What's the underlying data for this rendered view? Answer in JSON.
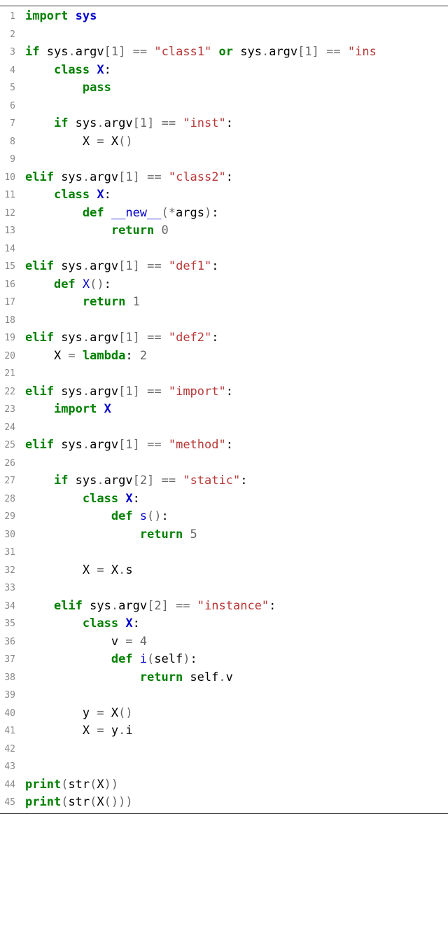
{
  "lines": [
    {
      "n": 1,
      "tokens": [
        [
          "kw-green",
          "import"
        ],
        [
          "plain",
          " "
        ],
        [
          "kw-blue",
          "sys"
        ]
      ]
    },
    {
      "n": 2,
      "tokens": []
    },
    {
      "n": 3,
      "tokens": [
        [
          "kw-green",
          "if"
        ],
        [
          "plain",
          " sys"
        ],
        [
          "op",
          "."
        ],
        [
          "plain",
          "argv"
        ],
        [
          "op",
          "["
        ],
        [
          "num",
          "1"
        ],
        [
          "op",
          "]"
        ],
        [
          "plain",
          " "
        ],
        [
          "op",
          "=="
        ],
        [
          "plain",
          " "
        ],
        [
          "str",
          "\"class1\""
        ],
        [
          "plain",
          " "
        ],
        [
          "kw-green",
          "or"
        ],
        [
          "plain",
          " sys"
        ],
        [
          "op",
          "."
        ],
        [
          "plain",
          "argv"
        ],
        [
          "op",
          "["
        ],
        [
          "num",
          "1"
        ],
        [
          "op",
          "]"
        ],
        [
          "plain",
          " "
        ],
        [
          "op",
          "=="
        ],
        [
          "plain",
          " "
        ],
        [
          "str",
          "\"ins"
        ]
      ]
    },
    {
      "n": 4,
      "tokens": [
        [
          "plain",
          "    "
        ],
        [
          "kw-green",
          "class"
        ],
        [
          "plain",
          " "
        ],
        [
          "kw-blue",
          "X"
        ],
        [
          "plain",
          ":"
        ]
      ]
    },
    {
      "n": 5,
      "tokens": [
        [
          "plain",
          "        "
        ],
        [
          "kw-green",
          "pass"
        ]
      ]
    },
    {
      "n": 6,
      "tokens": []
    },
    {
      "n": 7,
      "tokens": [
        [
          "plain",
          "    "
        ],
        [
          "kw-green",
          "if"
        ],
        [
          "plain",
          " sys"
        ],
        [
          "op",
          "."
        ],
        [
          "plain",
          "argv"
        ],
        [
          "op",
          "["
        ],
        [
          "num",
          "1"
        ],
        [
          "op",
          "]"
        ],
        [
          "plain",
          " "
        ],
        [
          "op",
          "=="
        ],
        [
          "plain",
          " "
        ],
        [
          "str",
          "\"inst\""
        ],
        [
          "plain",
          ":"
        ]
      ]
    },
    {
      "n": 8,
      "tokens": [
        [
          "plain",
          "        X "
        ],
        [
          "op",
          "="
        ],
        [
          "plain",
          " X"
        ],
        [
          "op",
          "()"
        ]
      ]
    },
    {
      "n": 9,
      "tokens": []
    },
    {
      "n": 10,
      "tokens": [
        [
          "kw-green",
          "elif"
        ],
        [
          "plain",
          " sys"
        ],
        [
          "op",
          "."
        ],
        [
          "plain",
          "argv"
        ],
        [
          "op",
          "["
        ],
        [
          "num",
          "1"
        ],
        [
          "op",
          "]"
        ],
        [
          "plain",
          " "
        ],
        [
          "op",
          "=="
        ],
        [
          "plain",
          " "
        ],
        [
          "str",
          "\"class2\""
        ],
        [
          "plain",
          ":"
        ]
      ]
    },
    {
      "n": 11,
      "tokens": [
        [
          "plain",
          "    "
        ],
        [
          "kw-green",
          "class"
        ],
        [
          "plain",
          " "
        ],
        [
          "kw-blue",
          "X"
        ],
        [
          "plain",
          ":"
        ]
      ]
    },
    {
      "n": 12,
      "tokens": [
        [
          "plain",
          "        "
        ],
        [
          "kw-green",
          "def"
        ],
        [
          "plain",
          " "
        ],
        [
          "fn",
          "__new__"
        ],
        [
          "op",
          "(*"
        ],
        [
          "plain",
          "args"
        ],
        [
          "op",
          ")"
        ],
        [
          "plain",
          ":"
        ]
      ]
    },
    {
      "n": 13,
      "tokens": [
        [
          "plain",
          "            "
        ],
        [
          "kw-green",
          "return"
        ],
        [
          "plain",
          " "
        ],
        [
          "num",
          "0"
        ]
      ]
    },
    {
      "n": 14,
      "tokens": []
    },
    {
      "n": 15,
      "tokens": [
        [
          "kw-green",
          "elif"
        ],
        [
          "plain",
          " sys"
        ],
        [
          "op",
          "."
        ],
        [
          "plain",
          "argv"
        ],
        [
          "op",
          "["
        ],
        [
          "num",
          "1"
        ],
        [
          "op",
          "]"
        ],
        [
          "plain",
          " "
        ],
        [
          "op",
          "=="
        ],
        [
          "plain",
          " "
        ],
        [
          "str",
          "\"def1\""
        ],
        [
          "plain",
          ":"
        ]
      ]
    },
    {
      "n": 16,
      "tokens": [
        [
          "plain",
          "    "
        ],
        [
          "kw-green",
          "def"
        ],
        [
          "plain",
          " "
        ],
        [
          "fn",
          "X"
        ],
        [
          "op",
          "()"
        ],
        [
          "plain",
          ":"
        ]
      ]
    },
    {
      "n": 17,
      "tokens": [
        [
          "plain",
          "        "
        ],
        [
          "kw-green",
          "return"
        ],
        [
          "plain",
          " "
        ],
        [
          "num",
          "1"
        ]
      ]
    },
    {
      "n": 18,
      "tokens": []
    },
    {
      "n": 19,
      "tokens": [
        [
          "kw-green",
          "elif"
        ],
        [
          "plain",
          " sys"
        ],
        [
          "op",
          "."
        ],
        [
          "plain",
          "argv"
        ],
        [
          "op",
          "["
        ],
        [
          "num",
          "1"
        ],
        [
          "op",
          "]"
        ],
        [
          "plain",
          " "
        ],
        [
          "op",
          "=="
        ],
        [
          "plain",
          " "
        ],
        [
          "str",
          "\"def2\""
        ],
        [
          "plain",
          ":"
        ]
      ]
    },
    {
      "n": 20,
      "tokens": [
        [
          "plain",
          "    X "
        ],
        [
          "op",
          "="
        ],
        [
          "plain",
          " "
        ],
        [
          "kw-green",
          "lambda"
        ],
        [
          "plain",
          ": "
        ],
        [
          "num",
          "2"
        ]
      ]
    },
    {
      "n": 21,
      "tokens": []
    },
    {
      "n": 22,
      "tokens": [
        [
          "kw-green",
          "elif"
        ],
        [
          "plain",
          " sys"
        ],
        [
          "op",
          "."
        ],
        [
          "plain",
          "argv"
        ],
        [
          "op",
          "["
        ],
        [
          "num",
          "1"
        ],
        [
          "op",
          "]"
        ],
        [
          "plain",
          " "
        ],
        [
          "op",
          "=="
        ],
        [
          "plain",
          " "
        ],
        [
          "str",
          "\"import\""
        ],
        [
          "plain",
          ":"
        ]
      ]
    },
    {
      "n": 23,
      "tokens": [
        [
          "plain",
          "    "
        ],
        [
          "kw-green",
          "import"
        ],
        [
          "plain",
          " "
        ],
        [
          "kw-blue",
          "X"
        ]
      ]
    },
    {
      "n": 24,
      "tokens": []
    },
    {
      "n": 25,
      "tokens": [
        [
          "kw-green",
          "elif"
        ],
        [
          "plain",
          " sys"
        ],
        [
          "op",
          "."
        ],
        [
          "plain",
          "argv"
        ],
        [
          "op",
          "["
        ],
        [
          "num",
          "1"
        ],
        [
          "op",
          "]"
        ],
        [
          "plain",
          " "
        ],
        [
          "op",
          "=="
        ],
        [
          "plain",
          " "
        ],
        [
          "str",
          "\"method\""
        ],
        [
          "plain",
          ":"
        ]
      ]
    },
    {
      "n": 26,
      "tokens": []
    },
    {
      "n": 27,
      "tokens": [
        [
          "plain",
          "    "
        ],
        [
          "kw-green",
          "if"
        ],
        [
          "plain",
          " sys"
        ],
        [
          "op",
          "."
        ],
        [
          "plain",
          "argv"
        ],
        [
          "op",
          "["
        ],
        [
          "num",
          "2"
        ],
        [
          "op",
          "]"
        ],
        [
          "plain",
          " "
        ],
        [
          "op",
          "=="
        ],
        [
          "plain",
          " "
        ],
        [
          "str",
          "\"static\""
        ],
        [
          "plain",
          ":"
        ]
      ]
    },
    {
      "n": 28,
      "tokens": [
        [
          "plain",
          "        "
        ],
        [
          "kw-green",
          "class"
        ],
        [
          "plain",
          " "
        ],
        [
          "kw-blue",
          "X"
        ],
        [
          "plain",
          ":"
        ]
      ]
    },
    {
      "n": 29,
      "tokens": [
        [
          "plain",
          "            "
        ],
        [
          "kw-green",
          "def"
        ],
        [
          "plain",
          " "
        ],
        [
          "fn",
          "s"
        ],
        [
          "op",
          "()"
        ],
        [
          "plain",
          ":"
        ]
      ]
    },
    {
      "n": 30,
      "tokens": [
        [
          "plain",
          "                "
        ],
        [
          "kw-green",
          "return"
        ],
        [
          "plain",
          " "
        ],
        [
          "num",
          "5"
        ]
      ]
    },
    {
      "n": 31,
      "tokens": []
    },
    {
      "n": 32,
      "tokens": [
        [
          "plain",
          "        X "
        ],
        [
          "op",
          "="
        ],
        [
          "plain",
          " X"
        ],
        [
          "op",
          "."
        ],
        [
          "plain",
          "s"
        ]
      ]
    },
    {
      "n": 33,
      "tokens": []
    },
    {
      "n": 34,
      "tokens": [
        [
          "plain",
          "    "
        ],
        [
          "kw-green",
          "elif"
        ],
        [
          "plain",
          " sys"
        ],
        [
          "op",
          "."
        ],
        [
          "plain",
          "argv"
        ],
        [
          "op",
          "["
        ],
        [
          "num",
          "2"
        ],
        [
          "op",
          "]"
        ],
        [
          "plain",
          " "
        ],
        [
          "op",
          "=="
        ],
        [
          "plain",
          " "
        ],
        [
          "str",
          "\"instance\""
        ],
        [
          "plain",
          ":"
        ]
      ]
    },
    {
      "n": 35,
      "tokens": [
        [
          "plain",
          "        "
        ],
        [
          "kw-green",
          "class"
        ],
        [
          "plain",
          " "
        ],
        [
          "kw-blue",
          "X"
        ],
        [
          "plain",
          ":"
        ]
      ]
    },
    {
      "n": 36,
      "tokens": [
        [
          "plain",
          "            v "
        ],
        [
          "op",
          "="
        ],
        [
          "plain",
          " "
        ],
        [
          "num",
          "4"
        ]
      ]
    },
    {
      "n": 37,
      "tokens": [
        [
          "plain",
          "            "
        ],
        [
          "kw-green",
          "def"
        ],
        [
          "plain",
          " "
        ],
        [
          "fn",
          "i"
        ],
        [
          "op",
          "("
        ],
        [
          "plain",
          "self"
        ],
        [
          "op",
          ")"
        ],
        [
          "plain",
          ":"
        ]
      ]
    },
    {
      "n": 38,
      "tokens": [
        [
          "plain",
          "                "
        ],
        [
          "kw-green",
          "return"
        ],
        [
          "plain",
          " self"
        ],
        [
          "op",
          "."
        ],
        [
          "plain",
          "v"
        ]
      ]
    },
    {
      "n": 39,
      "tokens": []
    },
    {
      "n": 40,
      "tokens": [
        [
          "plain",
          "        y "
        ],
        [
          "op",
          "="
        ],
        [
          "plain",
          " X"
        ],
        [
          "op",
          "()"
        ]
      ]
    },
    {
      "n": 41,
      "tokens": [
        [
          "plain",
          "        X "
        ],
        [
          "op",
          "="
        ],
        [
          "plain",
          " y"
        ],
        [
          "op",
          "."
        ],
        [
          "plain",
          "i"
        ]
      ]
    },
    {
      "n": 42,
      "tokens": []
    },
    {
      "n": 43,
      "tokens": []
    },
    {
      "n": 44,
      "tokens": [
        [
          "kw-green",
          "print"
        ],
        [
          "op",
          "("
        ],
        [
          "plain",
          "str"
        ],
        [
          "op",
          "("
        ],
        [
          "plain",
          "X"
        ],
        [
          "op",
          "))"
        ]
      ]
    },
    {
      "n": 45,
      "tokens": [
        [
          "kw-green",
          "print"
        ],
        [
          "op",
          "("
        ],
        [
          "plain",
          "str"
        ],
        [
          "op",
          "("
        ],
        [
          "plain",
          "X"
        ],
        [
          "op",
          "()))"
        ]
      ]
    }
  ]
}
